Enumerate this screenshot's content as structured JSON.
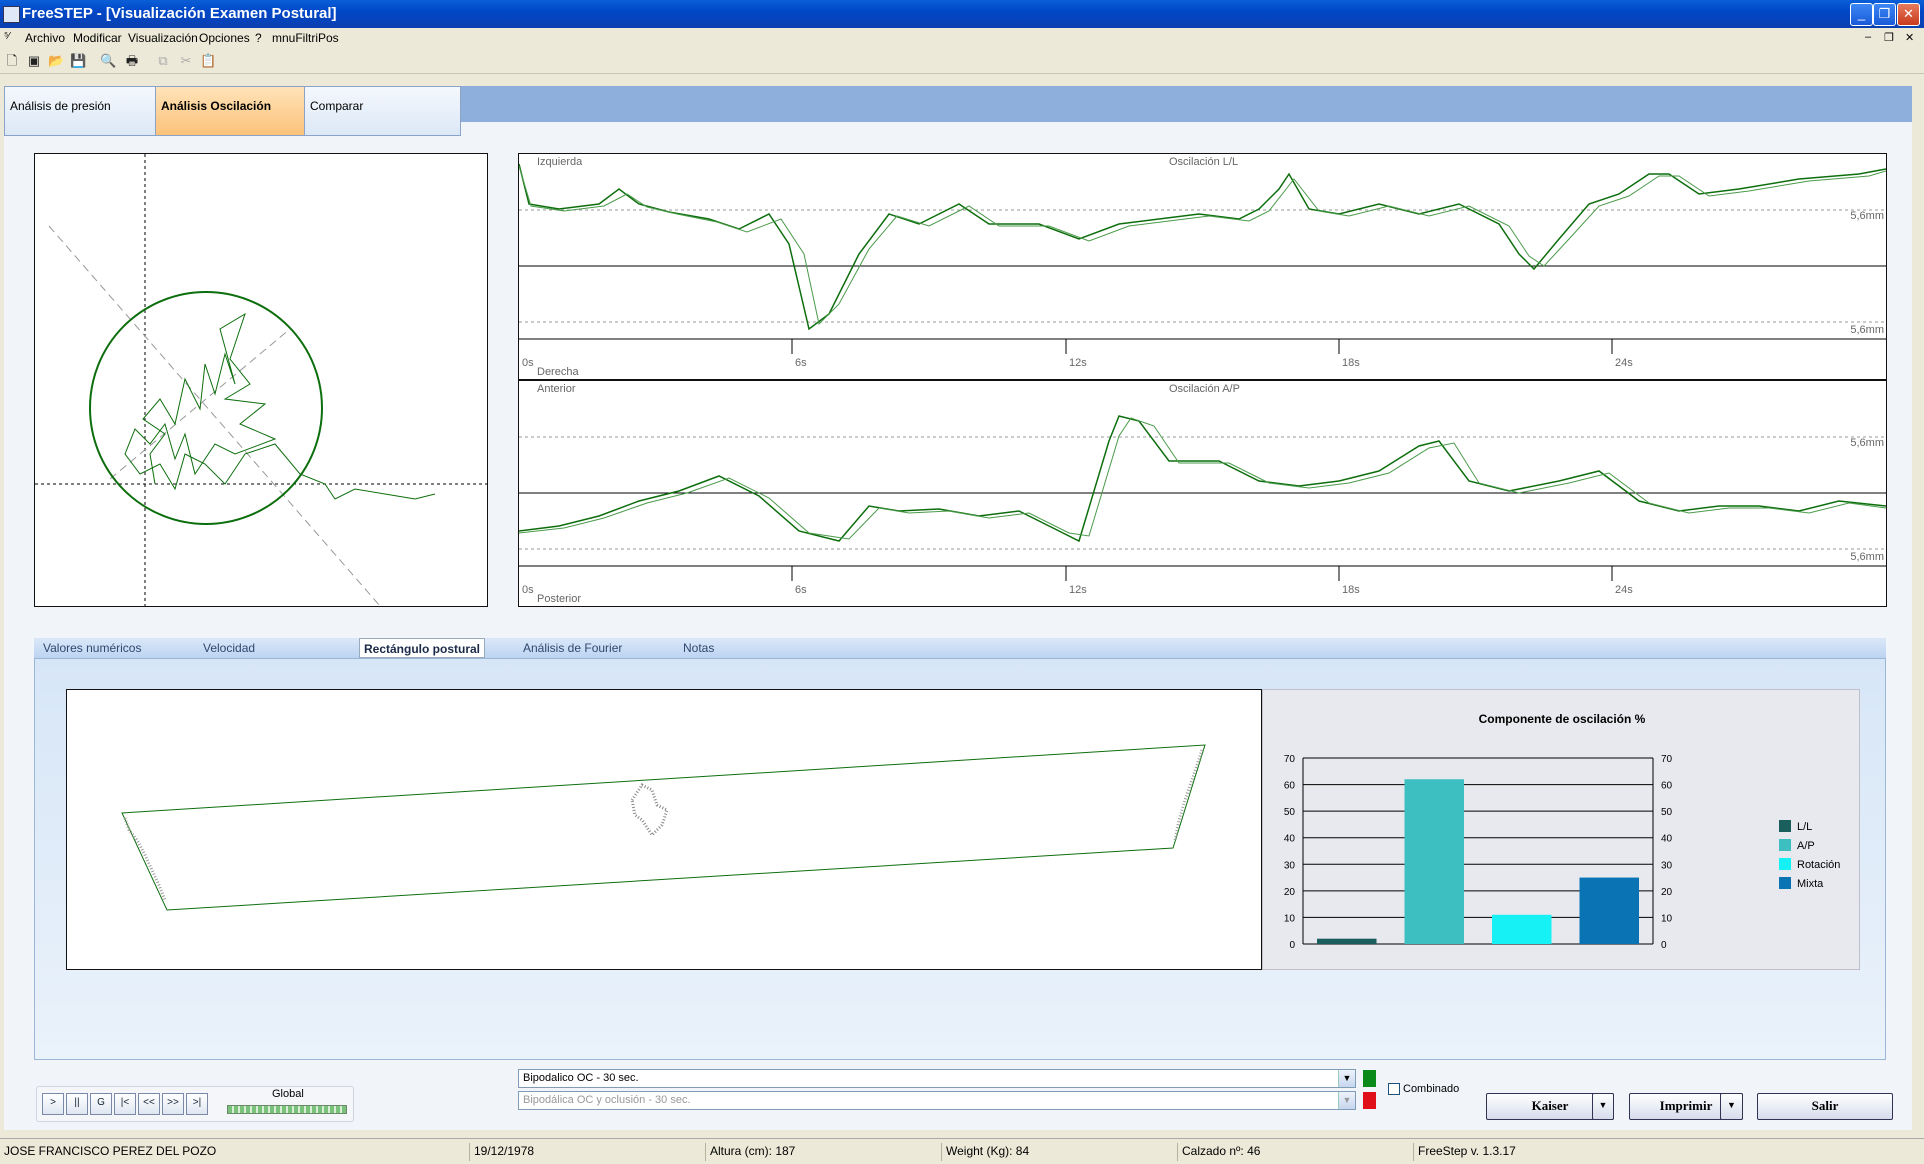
{
  "window": {
    "title": "FreeSTEP - [Visualización Examen Postural]"
  },
  "menu": [
    "Archivo",
    "Modificar",
    "Visualización",
    "Opciones",
    "?",
    "mnuFiltriPos"
  ],
  "main_tabs": [
    "Análisis de presión",
    "Análisis Oscilación",
    "Comparar"
  ],
  "active_main_tab": "Análisis Oscilación",
  "ll_chart": {
    "title": "Oscilación L/L",
    "top_label": "Izquierda",
    "bottom_label": "Derecha",
    "ticks": [
      "0s",
      "6s",
      "12s",
      "18s",
      "24s"
    ],
    "unit_top": "5,6mm",
    "unit_bottom": "5,6mm"
  },
  "ap_chart": {
    "title": "Oscilación A/P",
    "top_label": "Anterior",
    "bottom_label": "Posterior",
    "ticks": [
      "0s",
      "6s",
      "12s",
      "18s",
      "24s"
    ],
    "unit_top": "5,6mm",
    "unit_bottom": "5,6mm"
  },
  "lower_tabs": [
    "Valores numéricos",
    "Velocidad",
    "Rectángulo postural",
    "Análisis de Fourier",
    "Notas"
  ],
  "active_lower_tab": "Rectángulo postural",
  "chart_data": {
    "type": "bar",
    "title": "Componente de oscilación %",
    "categories": [
      "L/L",
      "A/P",
      "Rotación",
      "Mixta"
    ],
    "values": [
      2,
      62,
      11,
      25
    ],
    "colors": [
      "#1b5e5e",
      "#3dbfc1",
      "#16f1f6",
      "#0a73b4"
    ],
    "ylim": [
      0,
      70
    ],
    "yticks": [
      "0",
      "10",
      "20",
      "30",
      "40",
      "50",
      "60",
      "70"
    ],
    "legend": "right",
    "grid": true
  },
  "playback": {
    "buttons": [
      ">",
      "||",
      "G",
      "|<",
      "<<",
      ">>",
      ">|"
    ],
    "label": "Global"
  },
  "exam_select": {
    "primary": "Bipodalico OC - 30 sec.",
    "secondary": "Bipodálica OC y oclusión - 30 sec.",
    "primary_color": "#0a8a1a",
    "secondary_color": "#e0101a"
  },
  "combinado_label": "Combinado",
  "actions": {
    "kaiser": "Kaiser",
    "imprimir": "Imprimir",
    "salir": "Salir"
  },
  "status": {
    "patient": "JOSE FRANCISCO PEREZ DEL POZO",
    "date": "19/12/1978",
    "height": "Altura (cm): 187",
    "weight": "Weight (Kg): 84",
    "shoe": "Calzado nº: 46",
    "version": "FreeStep v. 1.3.17"
  }
}
